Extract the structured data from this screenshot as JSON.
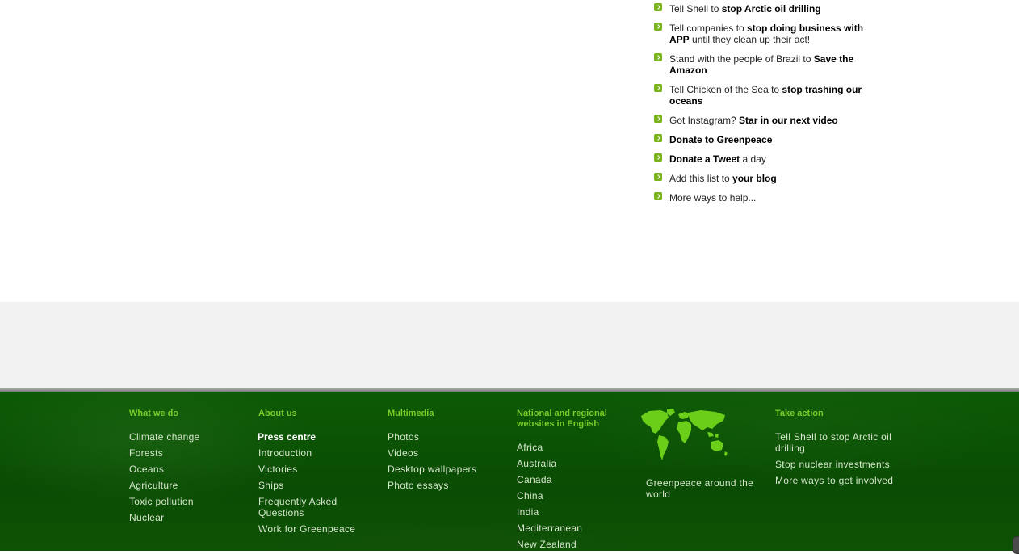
{
  "help_list": [
    {
      "pre": "Tell Shell to ",
      "bold": "stop Arctic oil drilling",
      "post": ""
    },
    {
      "pre": "Tell companies to ",
      "bold": "stop doing business with APP",
      "post": " until they clean up their act!"
    },
    {
      "pre": "Stand with the people of Brazil to ",
      "bold": "Save the Amazon",
      "post": ""
    },
    {
      "pre": "Tell Chicken of the Sea to ",
      "bold": "stop trashing our oceans",
      "post": ""
    },
    {
      "pre": "Got Instagram? ",
      "bold": "Star in our next video",
      "post": ""
    },
    {
      "pre": "",
      "bold": "Donate to Greenpeace",
      "post": ""
    },
    {
      "pre": "",
      "bold": "Donate a Tweet",
      "post": " a day"
    },
    {
      "pre": "Add this list to ",
      "bold": "your blog",
      "post": ""
    },
    {
      "pre": "More ways to help...",
      "bold": "",
      "post": ""
    }
  ],
  "footer": {
    "what_we_do": {
      "heading": "What we do",
      "items": [
        "Climate change",
        "Forests",
        "Oceans",
        "Agriculture",
        "Toxic pollution",
        "Nuclear"
      ]
    },
    "about_us": {
      "heading": "About us",
      "items": [
        "Press centre",
        "Introduction",
        "Victories",
        "Ships",
        "Frequently Asked Questions",
        "Work for Greenpeace"
      ]
    },
    "multimedia": {
      "heading": "Multimedia",
      "items": [
        "Photos",
        "Videos",
        "Desktop wallpapers",
        "Photo essays"
      ]
    },
    "national": {
      "heading": "National and regional websites in English",
      "items": [
        "Africa",
        "Australia",
        "Canada",
        "China",
        "India",
        "Mediterranean",
        "New Zealand"
      ]
    },
    "world": {
      "icon": "world-map-icon",
      "caption": "Greenpeace around the world"
    },
    "take_action": {
      "heading": "Take action",
      "items": [
        "Tell Shell to stop Arctic oil drilling",
        "Stop nuclear investments",
        "More ways to get involved"
      ]
    }
  },
  "colors": {
    "bullet": "#78b21d",
    "footer_heading": "#7ccd2a",
    "footer_bg": "#0a4c03",
    "grey_band": "#f2f2f2"
  }
}
